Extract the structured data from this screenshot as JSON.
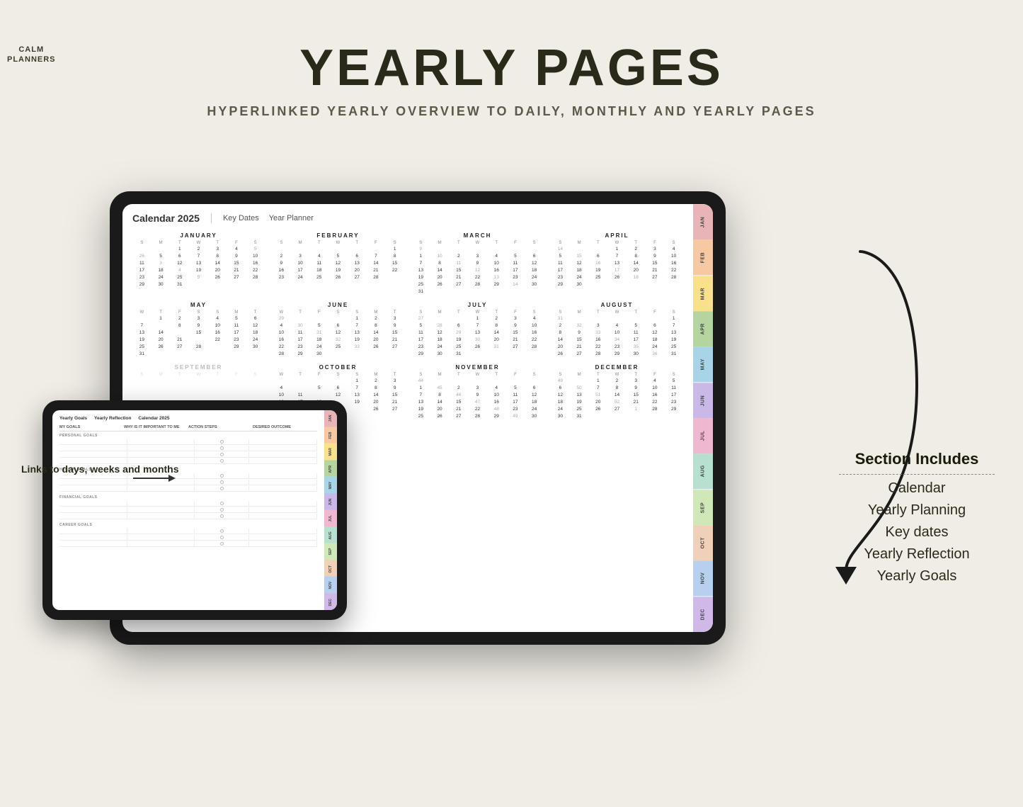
{
  "logo": {
    "line1": "CALM",
    "line2": "PLANNERS"
  },
  "header": {
    "title": "YEARLY PAGES",
    "subtitle": "HYPERLINKED YEARLY OVERVIEW TO DAILY, MONTHLY AND YEARLY PAGES"
  },
  "calendar": {
    "title": "Calendar 2025",
    "links": [
      "Key Dates",
      "Year Planner"
    ],
    "months": [
      {
        "name": "JANUARY",
        "days_header": [
          "S",
          "M",
          "T",
          "W",
          "T",
          "F",
          "S"
        ],
        "weeks": [
          [
            "",
            "",
            "1",
            "2",
            "3",
            "4",
            "",
            "5",
            "6",
            "7",
            "8",
            "9",
            "10",
            "11",
            "",
            "12",
            "13",
            "14",
            "15",
            "16",
            "17",
            "18",
            "",
            "19",
            "20",
            "21",
            "22",
            "23",
            "24",
            "25",
            "",
            "26",
            "27",
            "28",
            "29",
            "30",
            "31",
            ""
          ]
        ]
      },
      {
        "name": "FEBRUARY",
        "days_header": [
          "S",
          "M",
          "T",
          "W",
          "T",
          "F",
          "S"
        ]
      },
      {
        "name": "MARCH",
        "days_header": [
          "S",
          "M",
          "T",
          "W",
          "T",
          "F",
          "S"
        ]
      },
      {
        "name": "APRIL",
        "days_header": [
          "S",
          "M",
          "T",
          "W",
          "T",
          "F",
          "S"
        ]
      },
      {
        "name": "MAY",
        "days_header": [
          "S",
          "M",
          "T",
          "W",
          "T",
          "F",
          "S"
        ]
      },
      {
        "name": "JUNE",
        "days_header": [
          "S",
          "M",
          "T",
          "W",
          "T",
          "F",
          "S"
        ]
      },
      {
        "name": "JULY",
        "days_header": [
          "S",
          "M",
          "T",
          "W",
          "T",
          "F",
          "S"
        ]
      },
      {
        "name": "AUGUST",
        "days_header": [
          "S",
          "M",
          "T",
          "W",
          "T",
          "F",
          "S"
        ]
      },
      {
        "name": "SEPTEMBER",
        "days_header": [
          "S",
          "M",
          "T",
          "W",
          "T",
          "F",
          "S"
        ]
      },
      {
        "name": "OCTOBER",
        "days_header": [
          "S",
          "M",
          "T",
          "W",
          "T",
          "F",
          "S"
        ]
      },
      {
        "name": "NOVEMBER",
        "days_header": [
          "S",
          "M",
          "T",
          "W",
          "T",
          "F",
          "S"
        ]
      },
      {
        "name": "DECEMBER",
        "days_header": [
          "S",
          "M",
          "T",
          "W",
          "T",
          "F",
          "S"
        ]
      }
    ],
    "tabs": [
      "JAN",
      "FEB",
      "MAR",
      "APR",
      "MAY",
      "JUN",
      "JUL",
      "AUG",
      "SEP",
      "OCT",
      "NOV",
      "DEC"
    ]
  },
  "tabs_colors": [
    "#e8b4b8",
    "#f7c9a3",
    "#f9e08a",
    "#b5d5a0",
    "#a8d4e8",
    "#c9b8e8",
    "#f0b8d0",
    "#b8e0d0",
    "#d0e8b8",
    "#f0d0b8",
    "#b8d0f0",
    "#d0b8e8"
  ],
  "section_includes": {
    "title": "Section Includes",
    "items": [
      "Calendar",
      "Yearly Planning",
      "Key dates",
      "Yearly Reflection",
      "Yearly Goals"
    ]
  },
  "annotation": {
    "text": "Links to days,\nweeks and\nmonths"
  },
  "goals_page": {
    "tabs": [
      "Yearly Goals",
      "Yearly Reflection",
      "Calendar 2025"
    ],
    "columns": [
      "MY GOALS",
      "WHY IS IT IMPORTANT TO ME",
      "ACTION STEPS",
      "DESIRED OUTCOME"
    ],
    "sections": [
      "PERSONAL GOALS",
      "HEALTH GOALS",
      "FINANCIAL GOALS",
      "CAREER GOALS"
    ]
  }
}
